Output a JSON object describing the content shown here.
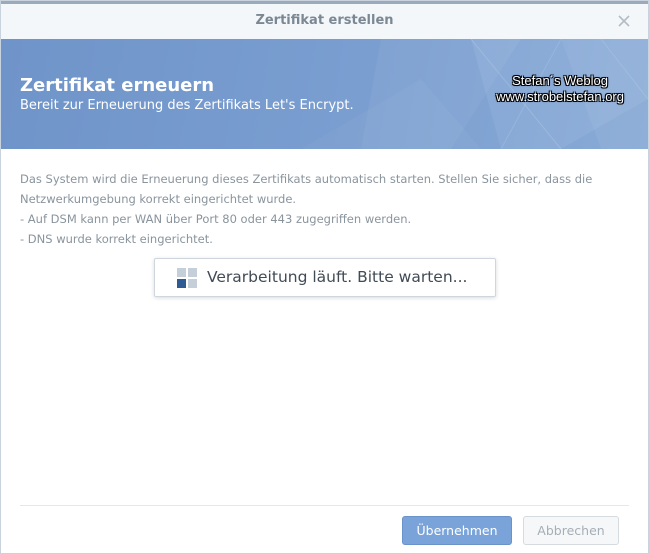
{
  "window": {
    "title": "Zertifikat erstellen",
    "close_icon": "close-icon"
  },
  "banner": {
    "title": "Zertifikat erneuern",
    "subtitle": "Bereit zur Erneuerung des Zertifikats Let's Encrypt.",
    "watermark_line1": "Stefan´s Weblog",
    "watermark_line2": "www.strobelstefan.org"
  },
  "content": {
    "line1": "Das System wird die Erneuerung dieses Zertifikats automatisch starten. Stellen Sie sicher, dass die Netzwerkumgebung korrekt eingerichtet wurde.",
    "line2": "- Auf DSM kann per WAN über Port 80 oder 443 zugegriffen werden.",
    "line3": "- DNS wurde korrekt eingerichtet."
  },
  "progress": {
    "text": "Verarbeitung läuft. Bitte warten...",
    "icon": "loading-spinner-icon"
  },
  "footer": {
    "apply_label": "Übernehmen",
    "cancel_label": "Abbrechen"
  },
  "colors": {
    "accent": "#79a3d9",
    "banner": "#7a9ed0",
    "text_muted": "#8a949d"
  }
}
